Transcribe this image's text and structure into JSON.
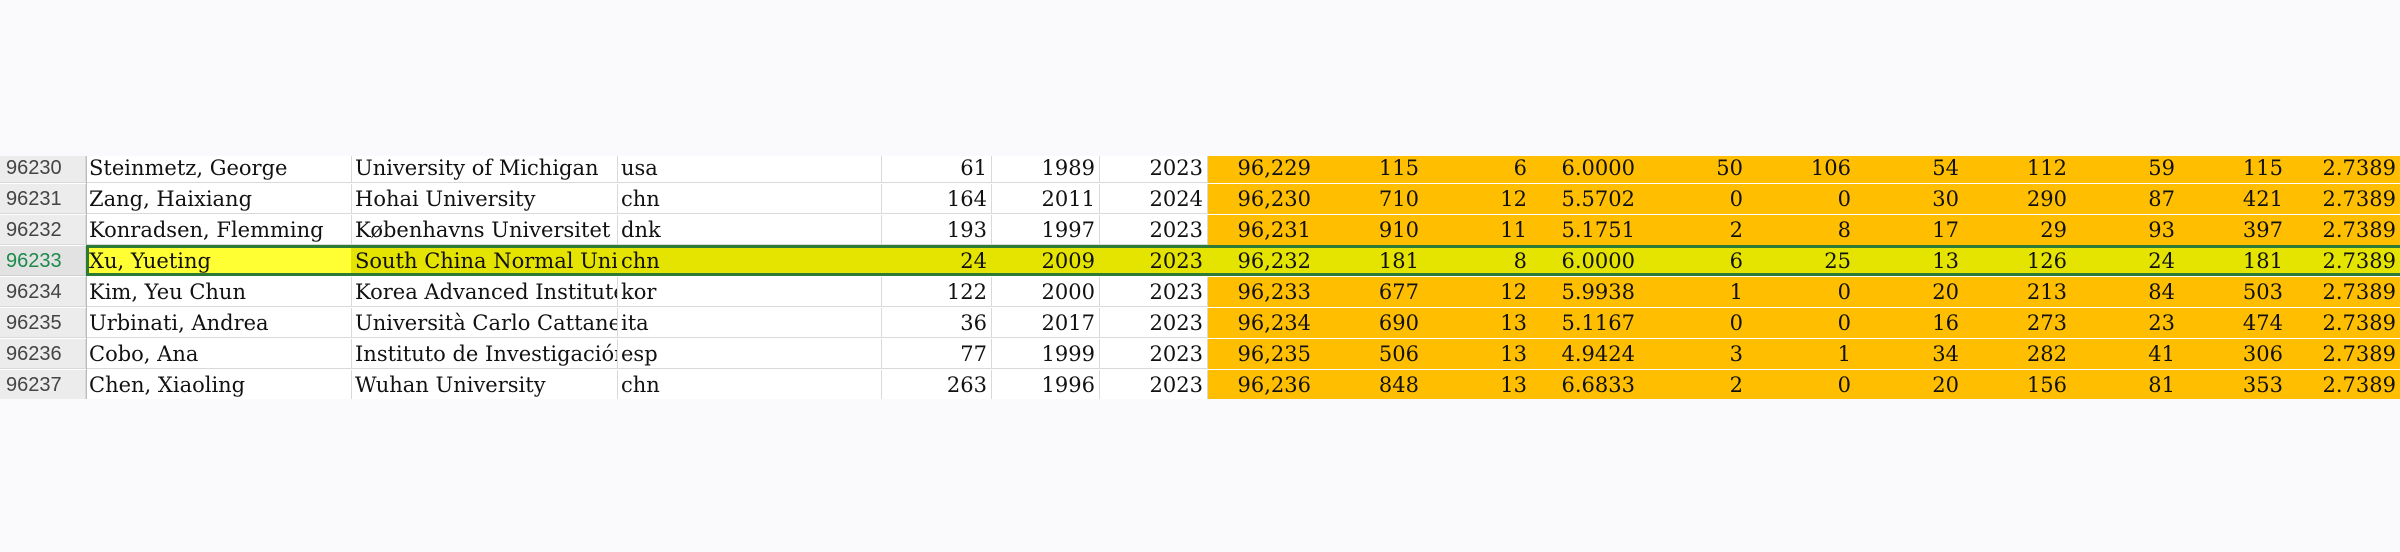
{
  "sheet": {
    "selected_row": "96233",
    "colors": {
      "highlight_orange": "#ffbf00",
      "selected_row_fill": "#e5e400",
      "selected_name_fill": "#ffff33",
      "selection_border": "#2d7a36",
      "row_header_selected_text": "#1c8a4a"
    },
    "rows": [
      {
        "id": "96230",
        "cells": [
          "Steinmetz, George",
          "University of Michigan",
          "usa",
          "61",
          "1989",
          "2023",
          "96,229",
          "115",
          "6",
          "6.0000",
          "50",
          "106",
          "54",
          "112",
          "59",
          "115",
          "2.7389"
        ]
      },
      {
        "id": "96231",
        "cells": [
          "Zang, Haixiang",
          "Hohai University",
          "chn",
          "164",
          "2011",
          "2024",
          "96,230",
          "710",
          "12",
          "5.5702",
          "0",
          "0",
          "30",
          "290",
          "87",
          "421",
          "2.7389"
        ]
      },
      {
        "id": "96232",
        "cells": [
          "Konradsen, Flemming",
          "Københavns Universitet",
          "dnk",
          "193",
          "1997",
          "2023",
          "96,231",
          "910",
          "11",
          "5.1751",
          "2",
          "8",
          "17",
          "29",
          "93",
          "397",
          "2.7389"
        ]
      },
      {
        "id": "96233",
        "cells": [
          "Xu, Yueting",
          "South China Normal Univ",
          "chn",
          "24",
          "2009",
          "2023",
          "96,232",
          "181",
          "8",
          "6.0000",
          "6",
          "25",
          "13",
          "126",
          "24",
          "181",
          "2.7389"
        ]
      },
      {
        "id": "96234",
        "cells": [
          "Kim, Yeu Chun",
          "Korea Advanced Institute",
          "kor",
          "122",
          "2000",
          "2023",
          "96,233",
          "677",
          "12",
          "5.9938",
          "1",
          "0",
          "20",
          "213",
          "84",
          "503",
          "2.7389"
        ]
      },
      {
        "id": "96235",
        "cells": [
          "Urbinati, Andrea",
          "Università Carlo Cattaneo",
          "ita",
          "36",
          "2017",
          "2023",
          "96,234",
          "690",
          "13",
          "5.1167",
          "0",
          "0",
          "16",
          "273",
          "23",
          "474",
          "2.7389"
        ]
      },
      {
        "id": "96236",
        "cells": [
          "Cobo, Ana",
          "Instituto de Investigación",
          "esp",
          "77",
          "1999",
          "2023",
          "96,235",
          "506",
          "13",
          "4.9424",
          "3",
          "1",
          "34",
          "282",
          "41",
          "306",
          "2.7389"
        ]
      },
      {
        "id": "96237",
        "cells": [
          "Chen, Xiaoling",
          "Wuhan University",
          "chn",
          "263",
          "1996",
          "2023",
          "96,236",
          "848",
          "13",
          "6.6833",
          "2",
          "0",
          "20",
          "156",
          "81",
          "353",
          "2.7389"
        ]
      }
    ]
  }
}
